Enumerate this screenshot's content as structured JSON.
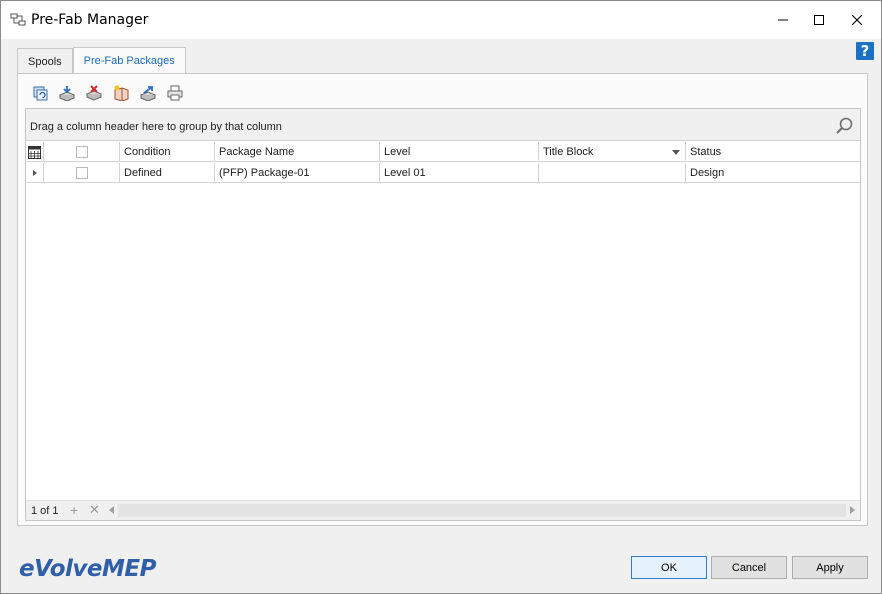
{
  "window": {
    "title": "Pre-Fab Manager",
    "help_label": "?"
  },
  "tabs": [
    {
      "label": "Spools",
      "active": false
    },
    {
      "label": "Pre-Fab Packages",
      "active": true
    }
  ],
  "toolbar": {
    "icons": [
      "refresh-icon",
      "import-icon",
      "delete-icon",
      "new-package-icon",
      "export-icon",
      "print-icon"
    ]
  },
  "grid": {
    "group_hint": "Drag a column header here to group by that column",
    "columns": [
      "Condition",
      "Package Name",
      "Level",
      "Title Block",
      "Status"
    ],
    "rows": [
      {
        "condition": "Defined",
        "package_name": "(PFP) Package-01",
        "level": "Level 01",
        "title_block": "",
        "status": "Design"
      }
    ],
    "pager": {
      "text": "1 of 1",
      "add": "+",
      "delete": "✕"
    }
  },
  "brand": {
    "logo_e": "e",
    "logo_volve": "Volve",
    "logo_mep": "MEP"
  },
  "buttons": {
    "ok": "OK",
    "cancel": "Cancel",
    "apply": "Apply"
  },
  "colors": {
    "accent": "#1f6ab5",
    "help": "#1b72c4",
    "logo": "#2f5fa8"
  }
}
